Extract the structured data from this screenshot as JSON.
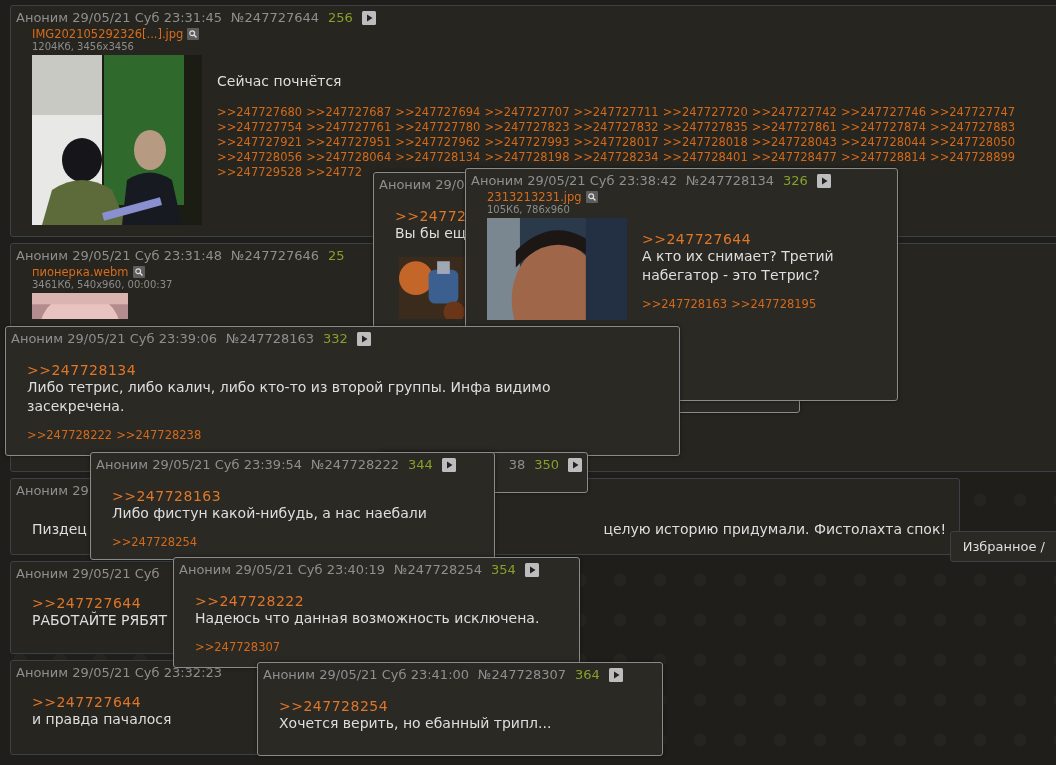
{
  "posts": [
    {
      "author": "Аноним",
      "date": "29/05/21 Суб 23:31:45",
      "number": "№247727644",
      "score": "256",
      "play": true,
      "file": {
        "name": "IMG202105292326[...].jpg",
        "info": "1204Кб, 3456x3456"
      },
      "text": "Сейчас почнётся",
      "replies": [
        ">>247727680",
        ">>247727687",
        ">>247727694",
        ">>247727707",
        ">>247727711",
        ">>247727720",
        ">>247727742",
        ">>247727746",
        ">>247727747",
        ">>247727754",
        ">>247727761",
        ">>247727780",
        ">>247727823",
        ">>247727832",
        ">>247727835",
        ">>247727861",
        ">>247727874",
        ">>247727883",
        ">>247727921",
        ">>247727951",
        ">>247727962",
        ">>247727993",
        ">>247728017",
        ">>247728018",
        ">>247728043",
        ">>247728044",
        ">>247728050",
        ">>247728056",
        ">>247728064",
        ">>247728134",
        ">>247728198",
        ">>247728234",
        ">>247728401",
        ">>247728477",
        ">>247728814",
        ">>247728899",
        ">>247729528",
        ">>24772"
      ]
    },
    {
      "author": "Аноним",
      "date": "29/05/21 Суб 23:31:48",
      "number": "№247727646",
      "score": "25",
      "file": {
        "name": "пионерка.webm",
        "info": "3461Кб, 540x960, 00:00:37"
      }
    },
    {
      "author": "Аноним",
      "date": "29",
      "text": "Пиздец",
      "text_tail": "целую историю придумали. Фистолахта спок!"
    },
    {
      "author": "Аноним",
      "date": "29/05/21 Суб",
      "quote": ">>247727644",
      "text": "РАБОТАЙТЕ РЯБЯТ"
    },
    {
      "author": "Аноним",
      "date": "29/05/21 Суб 23:32:23",
      "quote": ">>247727644",
      "text": "и правда пачалося"
    }
  ],
  "popups": [
    {
      "author": "Аноним",
      "date": "29/0",
      "quote": ">>24772",
      "text": "Вы бы ещ"
    },
    {
      "author": "Аноним",
      "date": "29/05/21 Суб 23:38:42",
      "number": "№247728134",
      "score": "326",
      "play": true,
      "file": {
        "name": "2313213231.jpg",
        "info": "105Кб, 786x960"
      },
      "quote": ">>247727644",
      "text": "А кто их снимает? Третий набегатор - это Тетрис?",
      "replies": [
        ">>247728163",
        ">>247728195"
      ]
    },
    {
      "author": "Аноним",
      "date": "29/05/21 Суб 23:39:06",
      "number": "№247728163",
      "score": "332",
      "play": true,
      "quote": ">>247728134",
      "text": "Либо тетрис, либо калич, либо кто-то из второй группы. Инфа видимо засекречена.",
      "replies": [
        ">>247728222",
        ">>247728238"
      ]
    },
    {
      "number": "38",
      "score": "350",
      "play": true
    },
    {
      "author": "Аноним",
      "date": "29/05/21 Суб 23:39:54",
      "number": "№247728222",
      "score": "344",
      "play": true,
      "quote": ">>247728163",
      "text": "Либо фистун какой-нибудь, а нас наебали",
      "replies": [
        ">>247728254"
      ]
    },
    {
      "author": "Аноним",
      "date": "29/05/21 Суб 23:40:19",
      "number": "№247728254",
      "score": "354",
      "play": true,
      "quote": ">>247728222",
      "text": "Надеюсь что данная возможность исключена.",
      "replies": [
        ">>247728307"
      ]
    },
    {
      "author": "Аноним",
      "date": "29/05/21 Суб 23:41:00",
      "number": "№247728307",
      "score": "364",
      "play": true,
      "quote": ">>247728254",
      "text": "Хочется верить, но ебанный трипл..."
    }
  ],
  "side_tab": {
    "label": "Избранное /"
  }
}
